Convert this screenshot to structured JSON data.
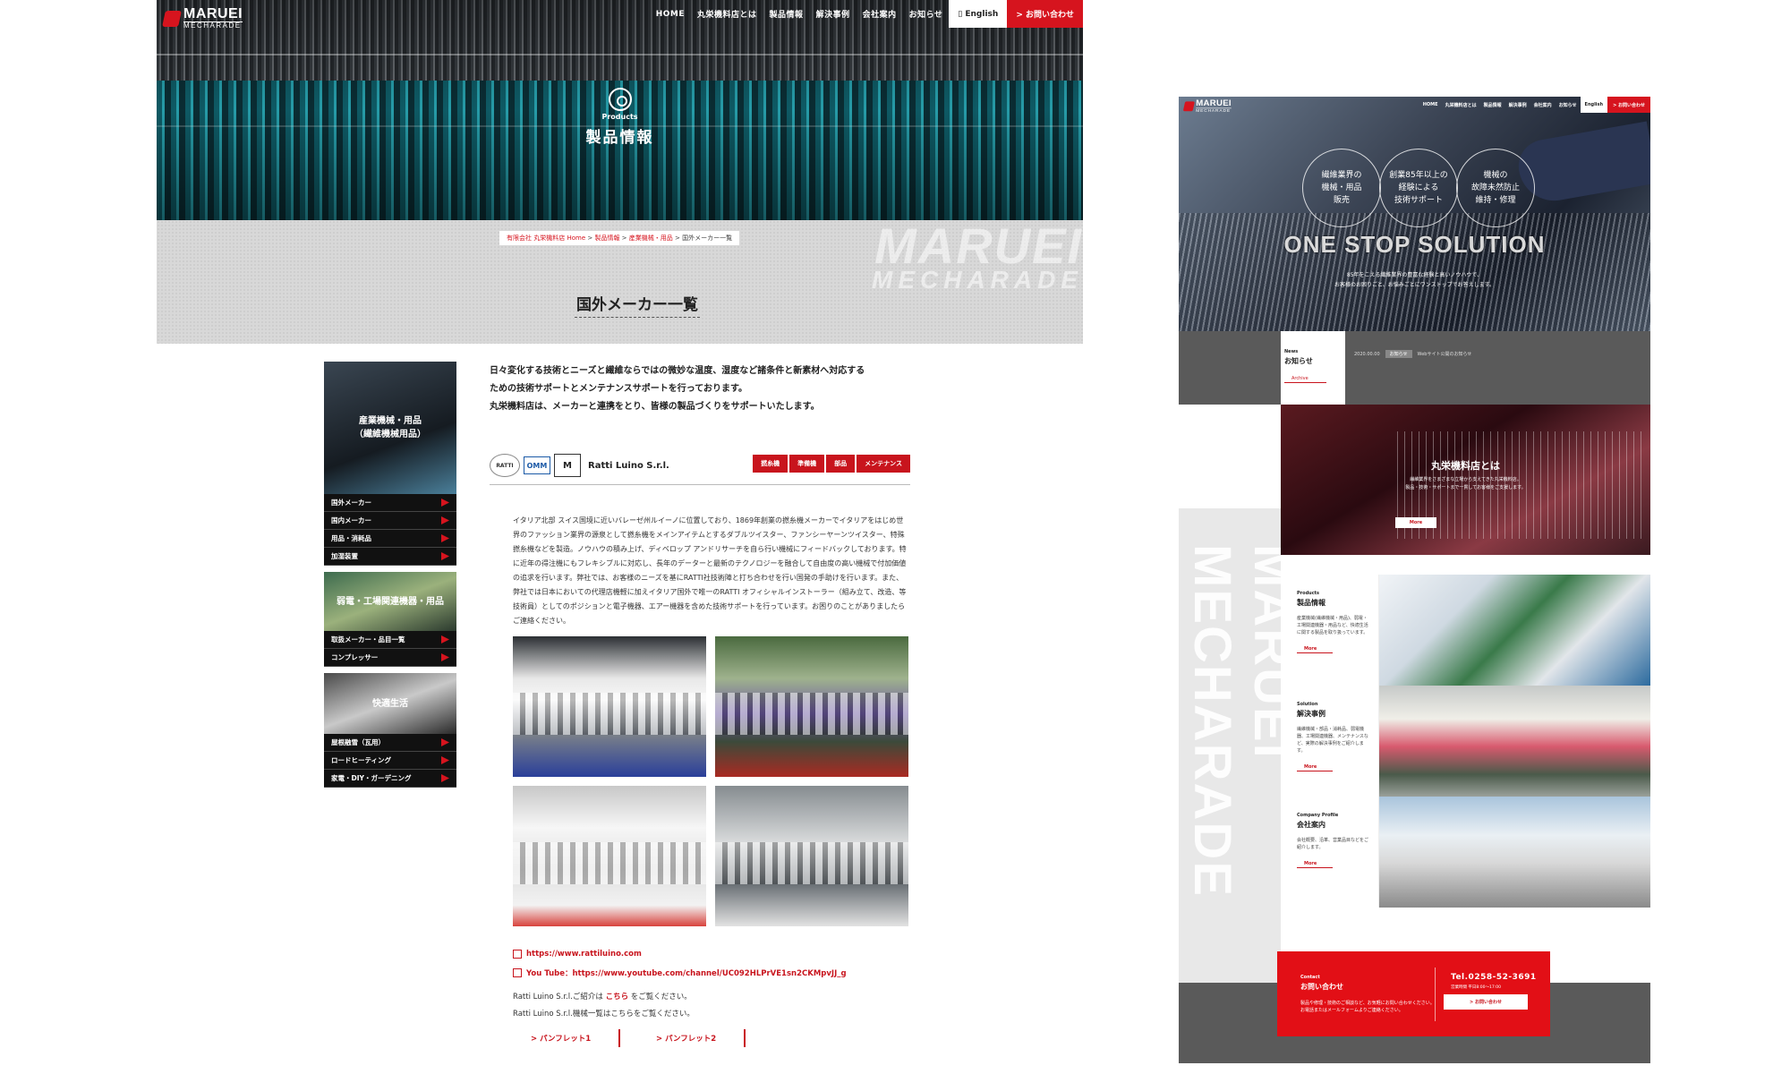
{
  "left_page": {
    "logo": {
      "line1": "MARUEI",
      "line2": "MECHARADE"
    },
    "nav": {
      "items": [
        "HOME",
        "丸栄機料店とは",
        "製品情報",
        "解決事例",
        "会社案内",
        "お知らせ"
      ],
      "english": "English",
      "contact": "> お問い合わせ"
    },
    "hero": {
      "sub": "Products",
      "title": "製品情報"
    },
    "watermark": {
      "line1": "MARUEI",
      "line2": "MECHARADE"
    },
    "breadcrumb": {
      "home": "有限会社 丸栄機料店 Home",
      "sep": " > ",
      "l2": "製品情報",
      "l3": "産業機械・用品",
      "current": "国外メーカー一覧"
    },
    "section_title": "国外メーカー一覧",
    "sidebar": {
      "block1": {
        "label_line1": "産業機械・用品",
        "label_line2": "（繊維機械用品）",
        "items": [
          "国外メーカー",
          "国内メーカー",
          "用品・消耗品",
          "加湿装置"
        ]
      },
      "block2": {
        "label": "弱電・工場関連機器・用品",
        "items": [
          "取扱メーカー・品目一覧",
          "コンプレッサー"
        ]
      },
      "block3": {
        "label": "快適生活",
        "items": [
          "屋根融雪（瓦用）",
          "ロードヒーティング",
          "家電・DIY・ガーデニング"
        ]
      }
    },
    "intro": [
      "日々変化する技術とニーズと繊維ならではの微妙な温度、湿度など諸条件と新素材へ対応する",
      "ための技術サポートとメンテナンスサポートを行っております。",
      "丸栄機料店は、メーカーと連携をとり、皆様の製品づくりをサポートいたします。"
    ],
    "maker": {
      "badges": [
        "RATTI",
        "OMM",
        "M"
      ],
      "name": "Ratti Luino S.r.l.",
      "tags": [
        "撚糸機",
        "準備機",
        "部品",
        "メンテナンス"
      ],
      "description": "イタリア北部 スイス国境に近いバレーゼ州ルイーノに位置しており、1869年創業の撚糸機メーカーでイタリアをはじめ世界のファッション業界の源泉として撚糸機をメインアイテムとするダブルツイスター、ファンシーヤーンツイスター、特殊撚糸機などを製造。ノウハウの積み上げ、ディベロップ アンドリサーチを自ら行い機械にフィードバックしております。特に近年の得注機にもフレキシブルに対応し、長年のデーターと最新のテクノロジーを融合して自由度の高い機械で付加価値の追求を行います。弊社では、お客様のニーズを基にRATTI社技術陣と打ち合わせを行い国発の手助けを行います。また、弊社では日本においての代理店機軽に加えイタリア国外で唯一のRATTI オフィシャルインストーラー（組み立て、改造、等技術員）としてのポジションと電子機器、エアー機器を含めた技術サポートを行っています。お困りのことがありましたらご連絡ください。",
      "links": [
        "https://www.rattiluino.com",
        "You Tube：https://www.youtube.com/channel/UC092HLPrVE1sn2CKMpvJJ_g"
      ],
      "note1_pre": "Ratti Luino S.r.l.ご紹介は",
      "note1_link": "こちら",
      "note1_post": "をご覧ください。",
      "note2": "Ratti Luino S.r.l.機械一覧はこちらをご覧ください。",
      "pamphlets": [
        "> パンフレット1",
        "> パンフレット2"
      ]
    }
  },
  "right_page": {
    "logo": {
      "line1": "MARUEI",
      "line2": "MECHARADE"
    },
    "nav": {
      "items": [
        "HOME",
        "丸栄機料店とは",
        "製品情報",
        "解決事例",
        "会社案内",
        "お知らせ"
      ],
      "english": "English",
      "contact": "> お問い合わせ"
    },
    "hero": {
      "circles": [
        [
          "繊維業界の",
          "機械・用品",
          "販売"
        ],
        [
          "創業85年以上の",
          "経験による",
          "技術サポート"
        ],
        [
          "機械の",
          "故障未然防止",
          "維持・修理"
        ]
      ],
      "headline": "ONE STOP SOLUTION",
      "sub_line1": "85年をこえる繊維業界の豊富な経験と高いノウハウで、",
      "sub_line2": "お客様のお困りごと、お悩みごとにワンストップでお答えします。"
    },
    "news": {
      "label": "News",
      "title": "お知らせ",
      "button": "Archive",
      "item_date": "2020.00.00",
      "item_tag": "お知らせ",
      "item_text": "Webサイト公開のお知らせ"
    },
    "about": {
      "title": "丸栄機料店とは",
      "desc_line1": "繊維業界をさまざまな立場から支えてきた丸栄機料店。",
      "desc_line2": "製品・技術・サポートまで一貫してお客様をご支援します。",
      "more": "More"
    },
    "watermark": "MARUEI MECHARADE",
    "cards": [
      {
        "label": "Products",
        "title": "製品情報",
        "desc": "産業機械(繊維機械・用品)、弱電・工場関連機器・用品など、快適生活に関する製品を取り扱っています。",
        "more": "More"
      },
      {
        "label": "Solution",
        "title": "解決事例",
        "desc": "繊維機械・部品・消耗品、弱電機器、工場関連機器、メンテナンスなど、実際の解決事例をご紹介します。",
        "more": "More"
      },
      {
        "label": "Company Profile",
        "title": "会社案内",
        "desc": "会社概要、沿革、営業品目などをご紹介します。",
        "more": "More"
      }
    ],
    "contact": {
      "label": "Contact",
      "title": "お問い合わせ",
      "desc_line1": "製品や修理・技術のご相談など、お気軽にお問い合わせください。",
      "desc_line2": "お電話またはメールフォームよりご連絡ください。",
      "tel": "Tel.0258-52-3691",
      "hours": "営業時間 平日8:00〜17:00",
      "button": "> お問い合わせ"
    }
  }
}
